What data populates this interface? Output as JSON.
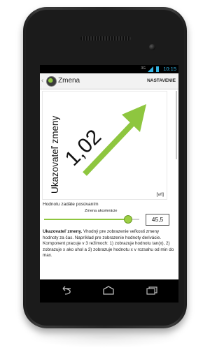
{
  "status_bar": {
    "time": "10:15",
    "mini_text": "3G"
  },
  "action_bar": {
    "title": "Zmena",
    "settings_label": "NASTAVENIE"
  },
  "indicator": {
    "label": "Ukazovateľ zmeny",
    "value": "1,02",
    "unit": "[v/t]"
  },
  "controls": {
    "hint": "Hodnotu zadáte posúvaním",
    "slider_label": "Zmena akcelerácie",
    "slider_position": 0.88,
    "value": "45,5"
  },
  "description": {
    "bold": "Ukazovateľ zmeny.",
    "text": " Vhodný pre zobrazenie veľkosti zmeny hodnoty za čas. Napríklad pre zobrazenie hodnoty derivácie. Komponent pracuje v 3 režimoch: 1) zobrazuje hodnotu tan(x), 2) zobrazuje x ako uhol a 3) zobrazuje hodnotu x v rozsahu od min do max."
  },
  "colors": {
    "accent_green": "#8ec63f",
    "holo_blue": "#34b5e5"
  },
  "icons": [
    "chevron-left-icon",
    "app-logo-icon",
    "back-icon",
    "home-icon",
    "recent-apps-icon"
  ]
}
